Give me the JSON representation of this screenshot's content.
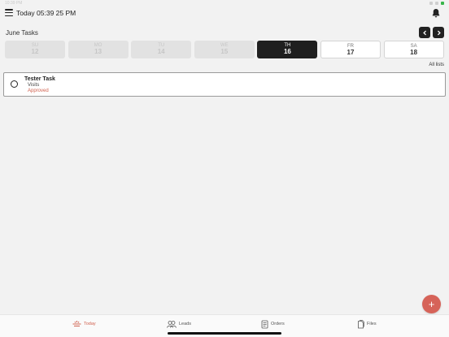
{
  "status_bar": {
    "left_text": "10:39 PM"
  },
  "header": {
    "title": "Today 05:39 25 PM"
  },
  "section": {
    "title": "June Tasks"
  },
  "days": [
    {
      "name": "SU",
      "date": "12"
    },
    {
      "name": "MO",
      "date": "13"
    },
    {
      "name": "TU",
      "date": "14"
    },
    {
      "name": "WE",
      "date": "15"
    },
    {
      "name": "TH",
      "date": "16"
    },
    {
      "name": "FR",
      "date": "17"
    },
    {
      "name": "SA",
      "date": "18"
    }
  ],
  "all_lists_label": "All lists",
  "task": {
    "title": "Tester Task",
    "type": "Visits",
    "status": "Approved"
  },
  "fab": {
    "label": "+"
  },
  "tabs": [
    {
      "label": "Today",
      "icon": "today-icon",
      "active": true
    },
    {
      "label": "Leads",
      "icon": "leads-icon",
      "active": false
    },
    {
      "label": "Orders",
      "icon": "orders-icon",
      "active": false
    },
    {
      "label": "Files",
      "icon": "files-icon",
      "active": false
    }
  ],
  "colors": {
    "accent": "#d0614f",
    "fab": "#d66359",
    "selected_day": "#1f1f1f"
  }
}
